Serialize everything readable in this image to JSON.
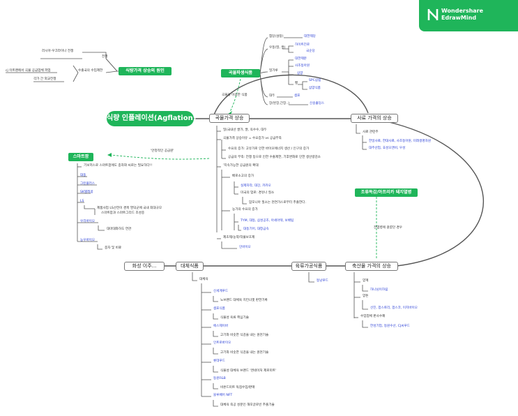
{
  "brand": {
    "line1": "Wondershare",
    "line2": "EdrawMind"
  },
  "center": "식량 인플레이션(Agflation)",
  "mains": {
    "grain": "곡물가격 상승",
    "feed": "사료 가격의 상승",
    "livestock": "축산물 가격의 상승",
    "processed": "육류가공식품",
    "alt": "대체식품",
    "other": "화성 이주...",
    "food": "곡물파생식품",
    "cause": "식량가격 상승의 원인",
    "smart": "스마트팜",
    "ai": "조류독감/아프리카 돼지열병"
  },
  "edge_labels": {
    "food_link": "곡물을 이용한 식품",
    "smart_link": "'안정적인 공급원'",
    "ai_link": "전염병에 걸렸던 경우"
  },
  "food": {
    "sugar": "첨당(설탕)",
    "sugar_c": "대한제당",
    "noodle": "우동(밀, 쌀)",
    "noodle_c": [
      "하이트진로",
      "국순당"
    ],
    "flour": "밀가루",
    "flour_c": [
      "대한제분",
      "사조동아원",
      "삼양"
    ],
    "bread": "빵",
    "bread_c": [
      "SPC삼립",
      "삼양식품"
    ],
    "beans": "대두",
    "beans_c": "샘표",
    "rice": "장(된장,간장..)",
    "rice_c": "신송홀딩스"
  },
  "cause": {
    "a": "러시아-우크라이나 전쟁",
    "a_tag": "전쟁",
    "b": "cj 이트랜에서 곡물 공급업체 파업",
    "b_tag": "수출국의 수입제한",
    "c": "각가 간 외교전쟁"
  },
  "grain": {
    "l1": "밀(국내산 쌀가, 쌀, 옥수수, 대두",
    "l2": "곡물가격 상승이유 = 수요증가 vs 공급부족",
    "l3": "수요의 증가: 고유가로 인한 바이오에너지 생산 / 인구의 증가",
    "l4": "공급의 부족: 전쟁 등으로 인한 수출제한, 기후변화로 인한 생산량감소",
    "l5": "'지속가능한 공급원의 확대",
    "l6": "배로소고의 증가",
    "l7": "실제자작, 대강, 카카오",
    "l8": "미국의 업로: 경유나 질소",
    "l9": "암모니아 질소는 천연가스로부터 추출한다.",
    "l10": "농가의 수요의 증가",
    "l11": "TYM, 대동, 삼성공조, 아세아텍, 보배팁",
    "l12": "대동기어, 대창금속",
    "l13": "제초제/농약/작물보호제",
    "l14": "인바이오"
  },
  "smart": {
    "l1": "기보저스로 스마트팜에도 종자와 씨로는 필요하다!!",
    "l2": "대동",
    "l3": "그린플러스",
    "l4": "SK텔레콤",
    "l5": "LS",
    "l6": "제품사업 LS산전이 경북 영덕군에 국내 최대규모",
    "l7": "스마트팜과 스마트그리드 조성중",
    "l8": "우리바이오",
    "l9": "대마대와하도 연관",
    "l10": "농우바이오",
    "l11": "종자 및 비료"
  },
  "feed": {
    "l1": "사료 관련주",
    "l2": "한일사료, 한대사료, 사조동아원, 미래생명자원",
    "l3": "대주산업, 효성오앤비, 우성"
  },
  "livestock": {
    "l1": "양계",
    "l2": "하나님이하림",
    "l3": "양돈",
    "l4": "선진, 팜스토리, 팜스코, 이지바이오",
    "l5": "수입업체 판사수혜",
    "l6": "한성기업, 동원수산, CJ씨푸드"
  },
  "processed": {
    "l1": "동남푸드"
  },
  "alt": {
    "l1": "대체육",
    "l2": "신세계푸드",
    "l3": "노브랜드 대체육 치킨너겟 판한기록",
    "l4": "샘표식품",
    "l5": "식물성 육류 핵심기술",
    "l6": "에스제이바",
    "l7": "고기와 비슷한 식감을 내는 원천기술",
    "l8": "인트로바이오",
    "l9": "고기와 비슷한 식감을 내는 원천기술",
    "l10": "롯데푸드",
    "l11": "식물성 대체육 브랜드 '엔네이처 제로미트'",
    "l12": "동원F&B",
    "l13": "비욘드미트 독점수입/판매",
    "l14": "블루베어 NFT",
    "l15": "대체육 죽공 성분인 해모글로빈 추출기술"
  }
}
